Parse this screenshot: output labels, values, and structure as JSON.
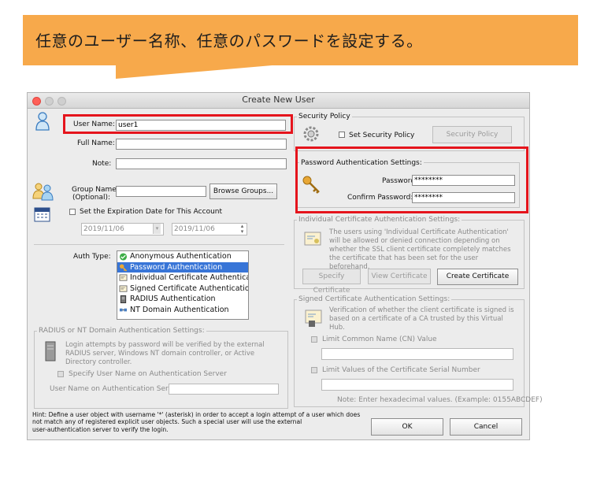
{
  "banner": {
    "text": "任意のユーザー名称、任意のパスワードを設定する。"
  },
  "window": {
    "title": "Create New User"
  },
  "user_name": {
    "label": "User Name:",
    "value": "user1"
  },
  "full_name": {
    "label": "Full Name:",
    "value": ""
  },
  "note": {
    "label": "Note:",
    "value": ""
  },
  "group": {
    "label_line1": "Group Name",
    "label_line2": "(Optional):",
    "value": "",
    "browse_button": "Browse Groups..."
  },
  "expiration": {
    "checkbox_label": "Set the Expiration Date for This Account",
    "date1": "2019/11/06",
    "date2": "2019/11/06"
  },
  "auth_type": {
    "label": "Auth Type:",
    "items": [
      {
        "label": "Anonymous Authentication",
        "icon": "check-circle-icon"
      },
      {
        "label": "Password Authentication",
        "icon": "key-icon",
        "selected": true
      },
      {
        "label": "Individual Certificate Authenticat...",
        "icon": "certificate-icon"
      },
      {
        "label": "Signed Certificate Authentication",
        "icon": "certificate-icon"
      },
      {
        "label": "RADIUS Authentication",
        "icon": "server-icon"
      },
      {
        "label": "NT Domain Authentication",
        "icon": "network-icon"
      }
    ]
  },
  "radius": {
    "group_title": "RADIUS or NT Domain Authentication Settings:",
    "description": "Login attempts by password will be verified by the external RADIUS server, Windows NT domain controller, or Active Directory controller.",
    "specify_checkbox": "Specify User Name on Authentication Server",
    "server_user_label": "User Name on Authentication Server:",
    "server_user_value": ""
  },
  "security_policy": {
    "group_title": "Security Policy",
    "checkbox_label": "Set Security Policy",
    "button": "Security Policy"
  },
  "password": {
    "group_title": "Password Authentication Settings:",
    "password_label": "Password:",
    "password_value": "********",
    "confirm_label": "Confirm Password:",
    "confirm_value": "********"
  },
  "individual_cert": {
    "group_title": "Individual Certificate Authentication Settings:",
    "description": "The users using 'Individual Certificate Authentication' will be allowed or denied connection depending on whether the SSL client certificate completely matches the certificate that has been set for the user beforehand.",
    "specify_button": "Specify Certificate",
    "view_button": "View Certificate",
    "create_button": "Create Certificate"
  },
  "signed_cert": {
    "group_title": "Signed Certificate Authentication Settings:",
    "description": "Verification of whether the client certificate is signed is based on a certificate of a CA trusted by this Virtual Hub.",
    "limit_cn_label": "Limit Common Name (CN) Value",
    "limit_serial_label": "Limit Values of the Certificate Serial Number",
    "note": "Note: Enter hexadecimal values. (Example: 0155ABCDEF)"
  },
  "hint": {
    "line1": "Hint: Define a user object with username '*' (asterisk) in order to accept a login attempt of a user which does",
    "line2": "not match any of registered explicit user objects. Such a special user will use the external",
    "line3": "user-authentication server to verify the login."
  },
  "buttons": {
    "ok": "OK",
    "cancel": "Cancel"
  },
  "colors": {
    "banner": "#f7a94b",
    "highlight": "#e5141c",
    "selected_row": "#3875d7"
  }
}
